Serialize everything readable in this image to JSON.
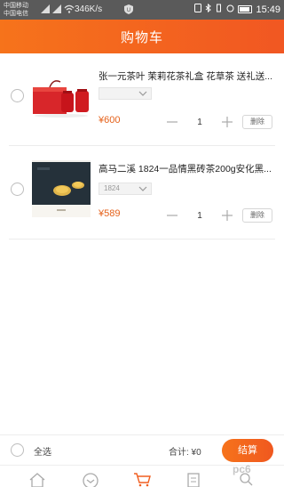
{
  "status_bar": {
    "carrier_1": "中国移动",
    "carrier_2": "中国电信",
    "speed": "346K/s",
    "time": "15:49"
  },
  "header": {
    "title": "购物车"
  },
  "cart": {
    "items": [
      {
        "name": "张一元茶叶 茉莉花茶礼盒 花草茶 送礼送...",
        "spec": "",
        "price": "¥600",
        "quantity": "1",
        "delete_label": "删除"
      },
      {
        "name": "高马二溪 1824一品情黑砖茶200g安化黑...",
        "spec": "1824",
        "price": "¥589",
        "quantity": "1",
        "delete_label": "删除"
      }
    ]
  },
  "bottom_bar": {
    "select_all_label": "全选",
    "total_label": "合计: ¥0",
    "checkout_label": "结算"
  },
  "watermark": "pc6",
  "colors": {
    "accent": "#f15f20",
    "price": "#e5621b"
  },
  "icons": {
    "tabs": [
      "home-icon",
      "category-icon",
      "cart-icon",
      "list-icon",
      "user-icon"
    ]
  }
}
